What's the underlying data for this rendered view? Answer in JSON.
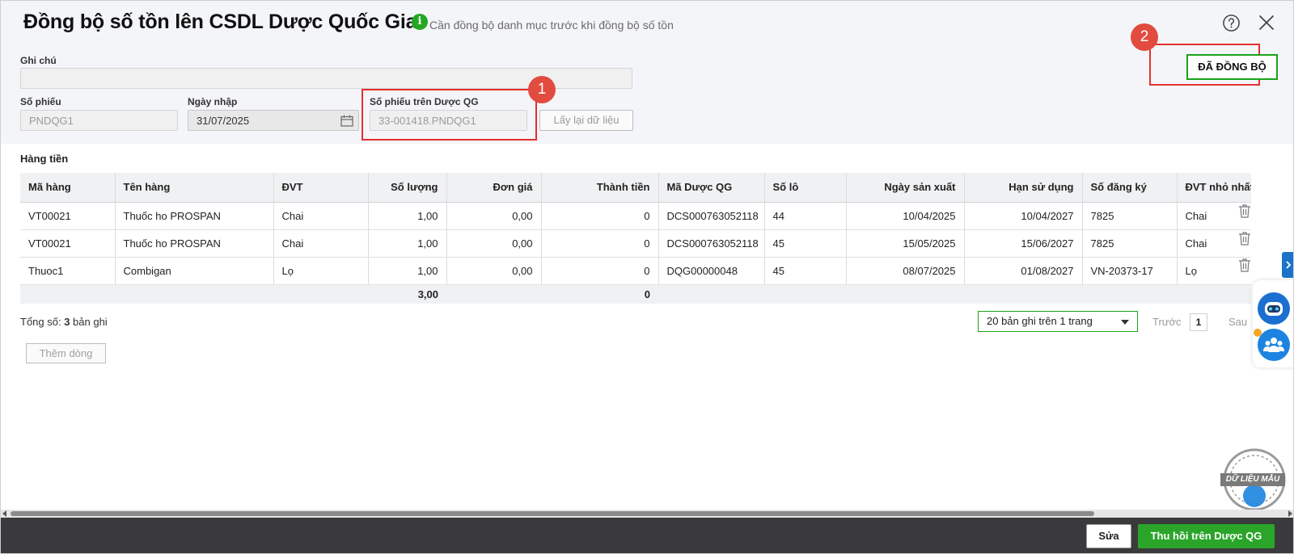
{
  "header": {
    "title": "Đồng bộ số tồn lên CSDL Dược Quốc Gia",
    "info_icon": "i",
    "subtitle": "Cần đồng bộ danh mục trước khi đồng bộ số tồn"
  },
  "form": {
    "note_label": "Ghi chú",
    "note_value": "",
    "voucher_no_label": "Số phiếu",
    "voucher_no_value": "PNDQG1",
    "import_date_label": "Ngày nhập",
    "import_date_value": "31/07/2025",
    "national_voucher_label": "Số phiếu trên Dược QG",
    "national_voucher_value": "33-001418.PNDQG1",
    "refetch_button": "Lấy lại dữ liệu",
    "synced_button": "ĐÃ ĐỒNG BỘ"
  },
  "annotations": {
    "marker_1": "1",
    "marker_2": "2",
    "box_color": "#e3302f"
  },
  "section": {
    "title": "Hàng tiền"
  },
  "table": {
    "columns": [
      "Mã hàng",
      "Tên hàng",
      "ĐVT",
      "Số lượng",
      "Đơn giá",
      "Thành tiền",
      "Mã Dược QG",
      "Số lô",
      "Ngày sản xuất",
      "Hạn sử dụng",
      "Số đăng ký",
      "ĐVT nhỏ nhất"
    ],
    "rows": [
      [
        "VT00021",
        "Thuốc ho PROSPAN",
        "Chai",
        "1,00",
        "0,00",
        "0",
        "DCS000763052118",
        "44",
        "10/04/2025",
        "10/04/2027",
        "7825",
        "Chai"
      ],
      [
        "VT00021",
        "Thuốc ho PROSPAN",
        "Chai",
        "1,00",
        "0,00",
        "0",
        "DCS000763052118",
        "45",
        "15/05/2025",
        "15/06/2027",
        "7825",
        "Chai"
      ],
      [
        "Thuoc1",
        "Combigan",
        "Lọ",
        "1,00",
        "0,00",
        "0",
        "DQG00000048",
        "45",
        "08/07/2025",
        "01/08/2027",
        "VN-20373-17",
        "Lọ"
      ]
    ],
    "totals": {
      "quantity": "3,00",
      "amount": "0"
    }
  },
  "footer": {
    "total_prefix": "Tổng số: ",
    "total_count": "3",
    "total_suffix": " bản ghi",
    "page_size": "20 bản ghi trên 1 trang",
    "prev": "Trước",
    "page": "1",
    "next": "Sau",
    "add_row": "Thêm dòng"
  },
  "stamp": {
    "label": "DỮ LIỆU MẪU"
  },
  "actions": {
    "edit": "Sửa",
    "recall": "Thu hồi trên Dược QG"
  },
  "colors": {
    "accent_green": "#2aa52a",
    "synced_border": "#1aa31a",
    "blue": "#1c6fd1"
  }
}
